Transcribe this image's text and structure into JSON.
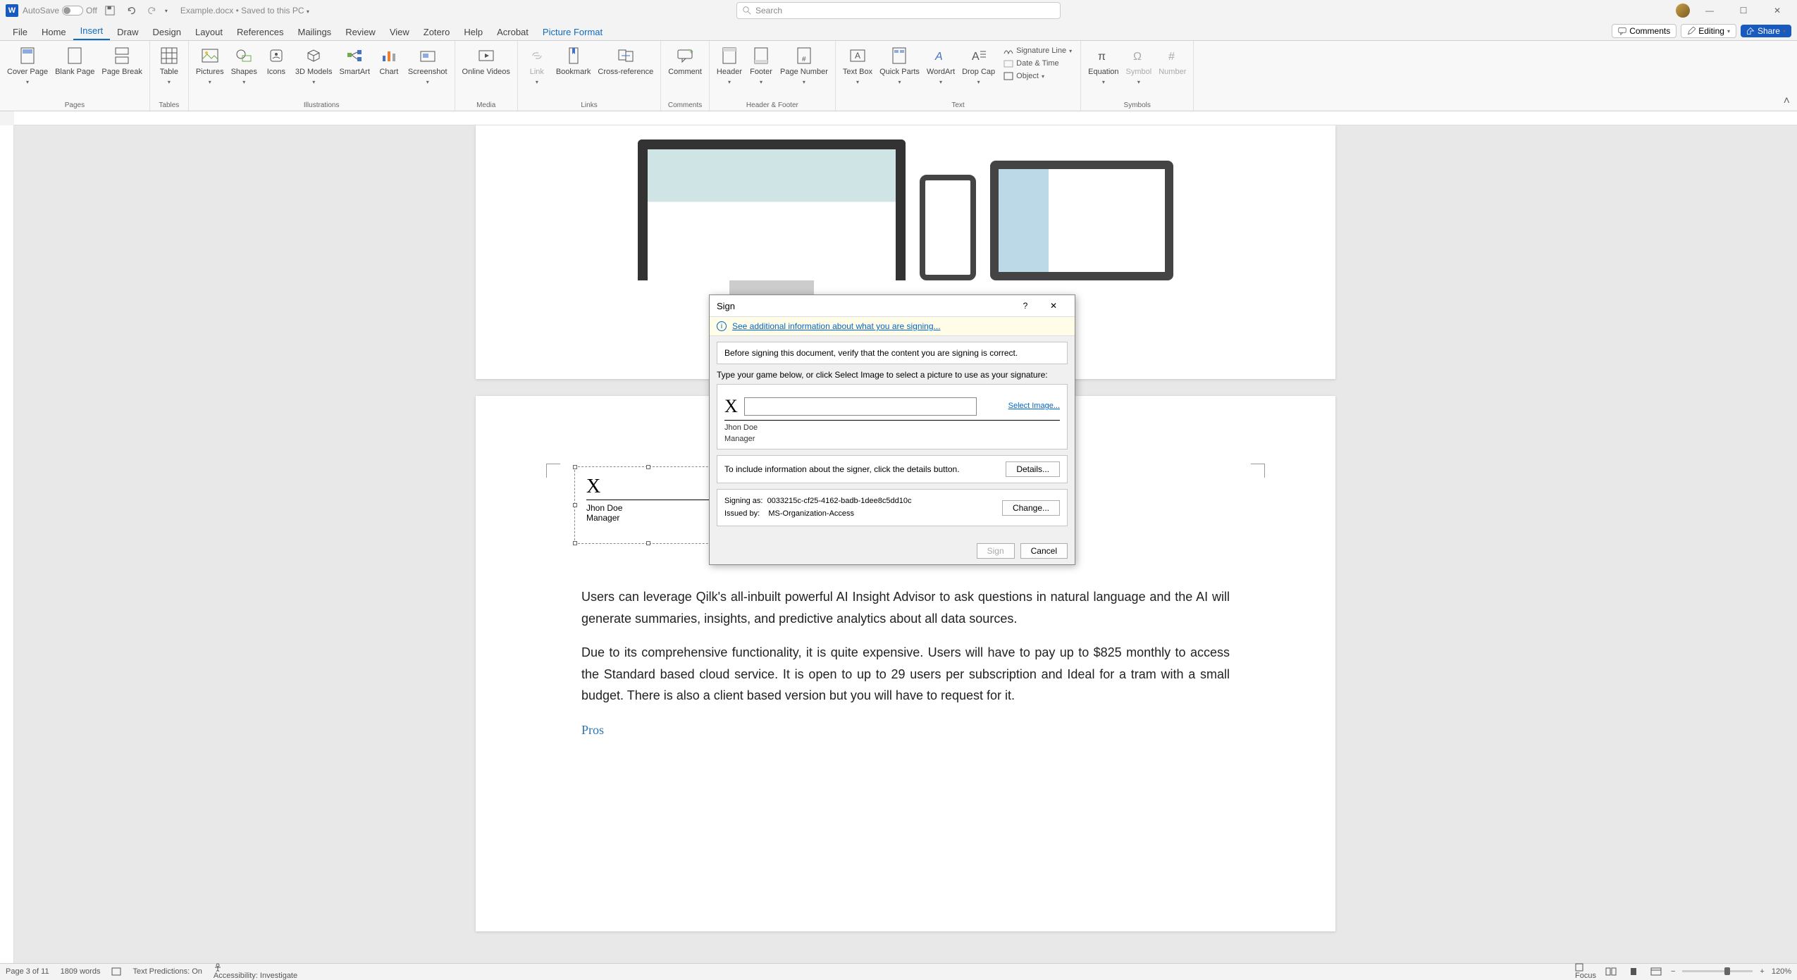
{
  "titlebar": {
    "autosave_label": "AutoSave",
    "autosave_state": "Off",
    "doc_name": "Example.docx",
    "doc_status": "Saved to this PC",
    "search_placeholder": "Search"
  },
  "tabs": {
    "file": "File",
    "home": "Home",
    "insert": "Insert",
    "draw": "Draw",
    "design": "Design",
    "layout": "Layout",
    "references": "References",
    "mailings": "Mailings",
    "review": "Review",
    "view": "View",
    "zotero": "Zotero",
    "help": "Help",
    "acrobat": "Acrobat",
    "picture_format": "Picture Format",
    "comments": "Comments",
    "editing": "Editing",
    "share": "Share"
  },
  "ribbon": {
    "pages": {
      "label": "Pages",
      "cover": "Cover Page",
      "blank": "Blank Page",
      "break": "Page Break"
    },
    "tables": {
      "label": "Tables",
      "table": "Table"
    },
    "illustrations": {
      "label": "Illustrations",
      "pictures": "Pictures",
      "shapes": "Shapes",
      "icons": "Icons",
      "models": "3D Models",
      "smartart": "SmartArt",
      "chart": "Chart",
      "screenshot": "Screenshot"
    },
    "media": {
      "label": "Media",
      "videos": "Online Videos"
    },
    "links": {
      "label": "Links",
      "link": "Link",
      "bookmark": "Bookmark",
      "crossref": "Cross-reference"
    },
    "comments": {
      "label": "Comments",
      "comment": "Comment"
    },
    "header_footer": {
      "label": "Header & Footer",
      "header": "Header",
      "footer": "Footer",
      "page_number": "Page Number"
    },
    "text": {
      "label": "Text",
      "textbox": "Text Box",
      "quickparts": "Quick Parts",
      "wordart": "WordArt",
      "dropcap": "Drop Cap",
      "sigline": "Signature Line",
      "datetime": "Date & Time",
      "object": "Object"
    },
    "symbols": {
      "label": "Symbols",
      "equation": "Equation",
      "symbol": "Symbol",
      "number": "Number"
    }
  },
  "document": {
    "sig": {
      "x": "X",
      "name": "Jhon Doe",
      "role": "Manager"
    },
    "para1": "Users can leverage Qilk's all-inbuilt powerful AI Insight Advisor to ask questions in natural language and the AI will generate summaries, insights, and predictive analytics about all data sources.",
    "para2": "Due to its comprehensive functionality, it is quite expensive. Users will have to pay up to $825 monthly to access the Standard based cloud service. It is open to up to 29 users per subscription and Ideal for a tram with a small budget. There is also a client based version but you will have to request for it.",
    "pros": "Pros"
  },
  "dialog": {
    "title": "Sign",
    "info_link": "See additional information about what you are signing...",
    "verify_text": "Before signing this document, verify that the content you are signing is correct.",
    "type_instr": "Type your game below, or click Select Image to select a picture to use as your signature:",
    "x": "X",
    "select_image": "Select Image...",
    "sig_name": "Jhon Doe",
    "sig_role": "Manager",
    "details_instr": "To include information about the signer, click the details button.",
    "details_btn": "Details...",
    "signing_as_label": "Signing as:",
    "signing_as_value": "0033215c-cf25-4162-badb-1dee8c5dd10c",
    "issued_by_label": "Issued by:",
    "issued_by_value": "MS-Organization-Access",
    "change_btn": "Change...",
    "sign_btn": "Sign",
    "cancel_btn": "Cancel"
  },
  "statusbar": {
    "page": "Page 3 of 11",
    "words": "1809 words",
    "predictions": "Text Predictions: On",
    "accessibility": "Accessibility: Investigate",
    "focus": "Focus",
    "zoom": "120%"
  }
}
